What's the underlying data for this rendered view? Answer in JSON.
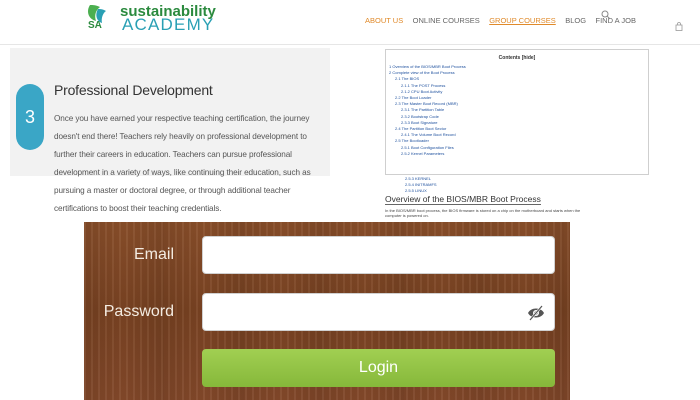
{
  "header": {
    "logo_line1": "sustainability",
    "logo_line2": "ACADEMY",
    "logo_mark_text": "SA",
    "nav": [
      {
        "label": "ABOUT US",
        "active": true
      },
      {
        "label": "ONLINE COURSES",
        "active": false
      },
      {
        "label": "GROUP COURSES",
        "active": true
      },
      {
        "label": "BLOG",
        "active": false
      },
      {
        "label": "FIND A JOB",
        "active": false
      }
    ],
    "icons": [
      "search-icon",
      "cart-icon"
    ],
    "accent_color": "#e08a2a"
  },
  "professional_development": {
    "step_number": "3",
    "title": "Professional Development",
    "body": "Once you have earned your respective teaching certification, the journey doesn't end there! Teachers rely heavily on professional development to further their careers in education. Teachers can pursue professional development in a variety of ways, like continuing their education, such as pursuing a master or doctoral degree, or through additional teacher certifications to boost their teaching credentials."
  },
  "toc": {
    "title": "Contents [hide]",
    "items": [
      {
        "text": "1 Overview of the BIOS/MBR Boot Process",
        "level": 1
      },
      {
        "text": "2 Complete view of the Boot Process",
        "level": 1
      },
      {
        "text": "2.1 The BIOS",
        "level": 2
      },
      {
        "text": "2.1.1 The POST Process",
        "level": 3
      },
      {
        "text": "2.1.2 CPU Boot Activity",
        "level": 3
      },
      {
        "text": "2.2 The Boot Loader",
        "level": 2
      },
      {
        "text": "2.3 The Master Boot Record (MBR)",
        "level": 2
      },
      {
        "text": "2.3.1 The Partition Table",
        "level": 3
      },
      {
        "text": "2.3.2 Bootstrap Code",
        "level": 3
      },
      {
        "text": "2.3.3 Boot Signature",
        "level": 3
      },
      {
        "text": "2.4 The Partition Boot Sector",
        "level": 2
      },
      {
        "text": "2.4.1 The Volume Boot Record",
        "level": 3
      },
      {
        "text": "2.5 The Bootloader",
        "level": 2
      },
      {
        "text": "2.5.1 Boot Configuration Files",
        "level": 3
      },
      {
        "text": "2.5.2 Kernel Parameters",
        "level": 3
      },
      {
        "text": "2.5.3 KERNEL",
        "level": 3
      },
      {
        "text": "2.5.4 INITRAMFS",
        "level": 3
      },
      {
        "text": "2.5.5 LINUX",
        "level": 3
      }
    ]
  },
  "overview": {
    "heading": "Overview of the BIOS/MBR Boot Process",
    "text": "In the BIOS/MBR boot process, the BIOS firmware is stored on a chip on the motherboard and starts when the computer is powered on."
  },
  "login": {
    "email_label": "Email",
    "password_label": "Password",
    "email_value": "",
    "password_value": "",
    "button_label": "Login",
    "button_color": "#8fc141"
  }
}
